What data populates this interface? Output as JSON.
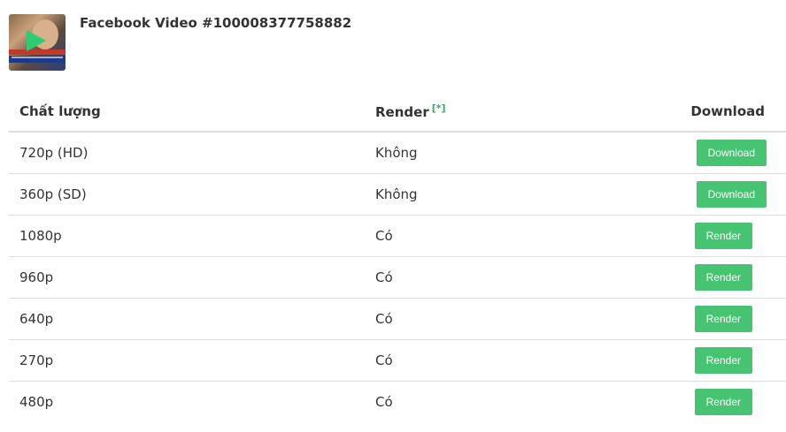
{
  "video": {
    "title": "Facebook Video #100008377758882"
  },
  "table": {
    "headers": {
      "quality": "Chất lượng",
      "render": "Render",
      "render_footnote": "[*]",
      "download": "Download"
    },
    "rows": [
      {
        "quality": "720p (HD)",
        "render": "Không",
        "action": "Download",
        "action_type": "download"
      },
      {
        "quality": "360p (SD)",
        "render": "Không",
        "action": "Download",
        "action_type": "download"
      },
      {
        "quality": "1080p",
        "render": "Có",
        "action": "Render",
        "action_type": "render"
      },
      {
        "quality": "960p",
        "render": "Có",
        "action": "Render",
        "action_type": "render"
      },
      {
        "quality": "640p",
        "render": "Có",
        "action": "Render",
        "action_type": "render"
      },
      {
        "quality": "270p",
        "render": "Có",
        "action": "Render",
        "action_type": "render"
      },
      {
        "quality": "480p",
        "render": "Có",
        "action": "Render",
        "action_type": "render"
      }
    ]
  },
  "colors": {
    "button": "#47c472",
    "footnote": "#2eae5f",
    "text": "#333333",
    "divider": "#dddddd"
  }
}
